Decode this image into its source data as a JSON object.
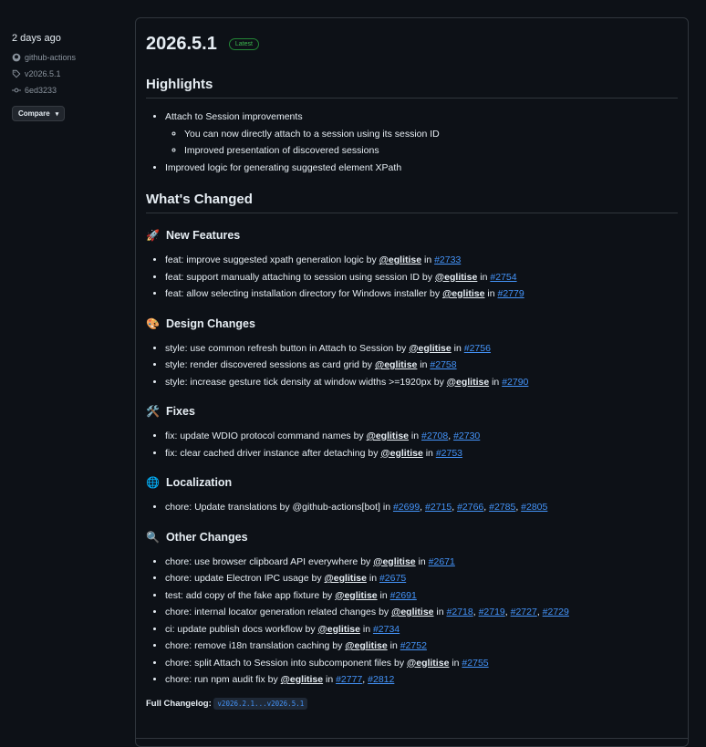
{
  "sidebar": {
    "date": "2 days ago",
    "author": "github-actions",
    "tag": "v2026.5.1",
    "commit": "6ed3233",
    "compare_label": "Compare"
  },
  "release": {
    "title": "2026.5.1",
    "badge": "Latest"
  },
  "highlights": {
    "heading": "Highlights",
    "item1": "Attach to Session improvements",
    "sub1": "You can now directly attach to a session using its session ID",
    "sub2": "Improved presentation of discovered sessions",
    "item2": "Improved logic for generating suggested element XPath"
  },
  "changed": {
    "heading": "What's Changed",
    "sections": [
      {
        "emoji": "🚀",
        "title": "New Features",
        "items": [
          {
            "text": "feat: improve suggested xpath generation logic by ",
            "user": "@eglitise",
            "in": " in ",
            "prs": [
              "#2733"
            ]
          },
          {
            "text": "feat: support manually attaching to session using session ID by ",
            "user": "@eglitise",
            "in": " in ",
            "prs": [
              "#2754"
            ]
          },
          {
            "text": "feat: allow selecting installation directory for Windows installer by ",
            "user": "@eglitise",
            "in": " in ",
            "prs": [
              "#2779"
            ]
          }
        ]
      },
      {
        "emoji": "🎨",
        "title": "Design Changes",
        "items": [
          {
            "text": "style: use common refresh button in Attach to Session by ",
            "user": "@eglitise",
            "in": " in ",
            "prs": [
              "#2756"
            ]
          },
          {
            "text": "style: render discovered sessions as card grid by ",
            "user": "@eglitise",
            "in": " in ",
            "prs": [
              "#2758"
            ]
          },
          {
            "text": "style: increase gesture tick density at window widths >=1920px by ",
            "user": "@eglitise",
            "in": " in ",
            "prs": [
              "#2790"
            ]
          }
        ]
      },
      {
        "emoji": "🛠️",
        "title": "Fixes",
        "items": [
          {
            "text": "fix: update WDIO protocol command names by ",
            "user": "@eglitise",
            "in": " in ",
            "prs": [
              "#2708",
              "#2730"
            ]
          },
          {
            "text": "fix: clear cached driver instance after detaching by ",
            "user": "@eglitise",
            "in": " in ",
            "prs": [
              "#2753"
            ]
          }
        ]
      },
      {
        "emoji": "🌐",
        "title": "Localization",
        "items": [
          {
            "text": "chore: Update translations by @github-actions[bot] in ",
            "user": "",
            "in": "",
            "prs": [
              "#2699",
              "#2715",
              "#2766",
              "#2785",
              "#2805"
            ]
          }
        ]
      },
      {
        "emoji": "🔍",
        "title": "Other Changes",
        "items": [
          {
            "text": "chore: use browser clipboard API everywhere by ",
            "user": "@eglitise",
            "in": " in ",
            "prs": [
              "#2671"
            ]
          },
          {
            "text": "chore: update Electron IPC usage by ",
            "user": "@eglitise",
            "in": " in ",
            "prs": [
              "#2675"
            ]
          },
          {
            "text": "test: add copy of the fake app fixture by ",
            "user": "@eglitise",
            "in": " in ",
            "prs": [
              "#2691"
            ]
          },
          {
            "text": "chore: internal locator generation related changes by ",
            "user": "@eglitise",
            "in": " in ",
            "prs": [
              "#2718",
              "#2719",
              "#2727",
              "#2729"
            ]
          },
          {
            "text": "ci: update publish docs workflow by ",
            "user": "@eglitise",
            "in": " in ",
            "prs": [
              "#2734"
            ]
          },
          {
            "text": "chore: remove i18n translation caching by ",
            "user": "@eglitise",
            "in": " in ",
            "prs": [
              "#2752"
            ]
          },
          {
            "text": "chore: split Attach to Session into subcomponent files by ",
            "user": "@eglitise",
            "in": " in ",
            "prs": [
              "#2755"
            ]
          },
          {
            "text": "chore: run npm audit fix by ",
            "user": "@eglitise",
            "in": " in ",
            "prs": [
              "#2777",
              "#2812"
            ]
          }
        ]
      }
    ]
  },
  "changelog": {
    "label": "Full Changelog:",
    "link": "v2026.2.1...v2026.5.1"
  }
}
